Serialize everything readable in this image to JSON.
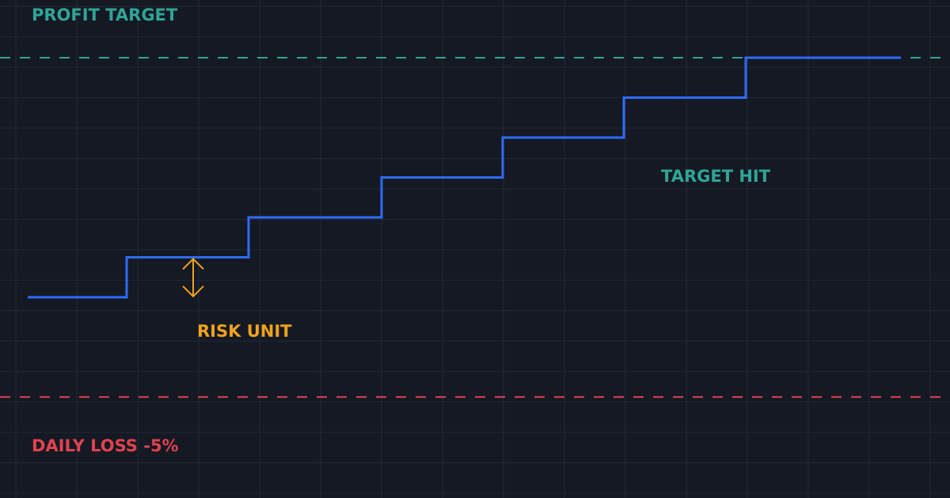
{
  "chart_data": {
    "type": "line",
    "title": "",
    "xlabel": "",
    "ylabel": "",
    "grid": true,
    "step_line": {
      "x": [
        0,
        1,
        2,
        3,
        4,
        5,
        6,
        7
      ],
      "y": [
        0,
        1,
        2,
        3,
        4,
        5,
        6,
        6
      ]
    },
    "profit_target": {
      "label": "PROFIT TARGET",
      "value": 6
    },
    "daily_loss": {
      "label": "DAILY LOSS -5%",
      "value": -2.5
    },
    "annotations": {
      "risk_unit": "RISK UNIT",
      "target_hit": "TARGET HIT"
    }
  },
  "colors": {
    "background": "#141923",
    "grid": "#222938",
    "equity_line": "#2f6bff",
    "profit_target": "#2fa596",
    "daily_loss": "#e0434f",
    "risk_unit": "#f0a21c"
  }
}
